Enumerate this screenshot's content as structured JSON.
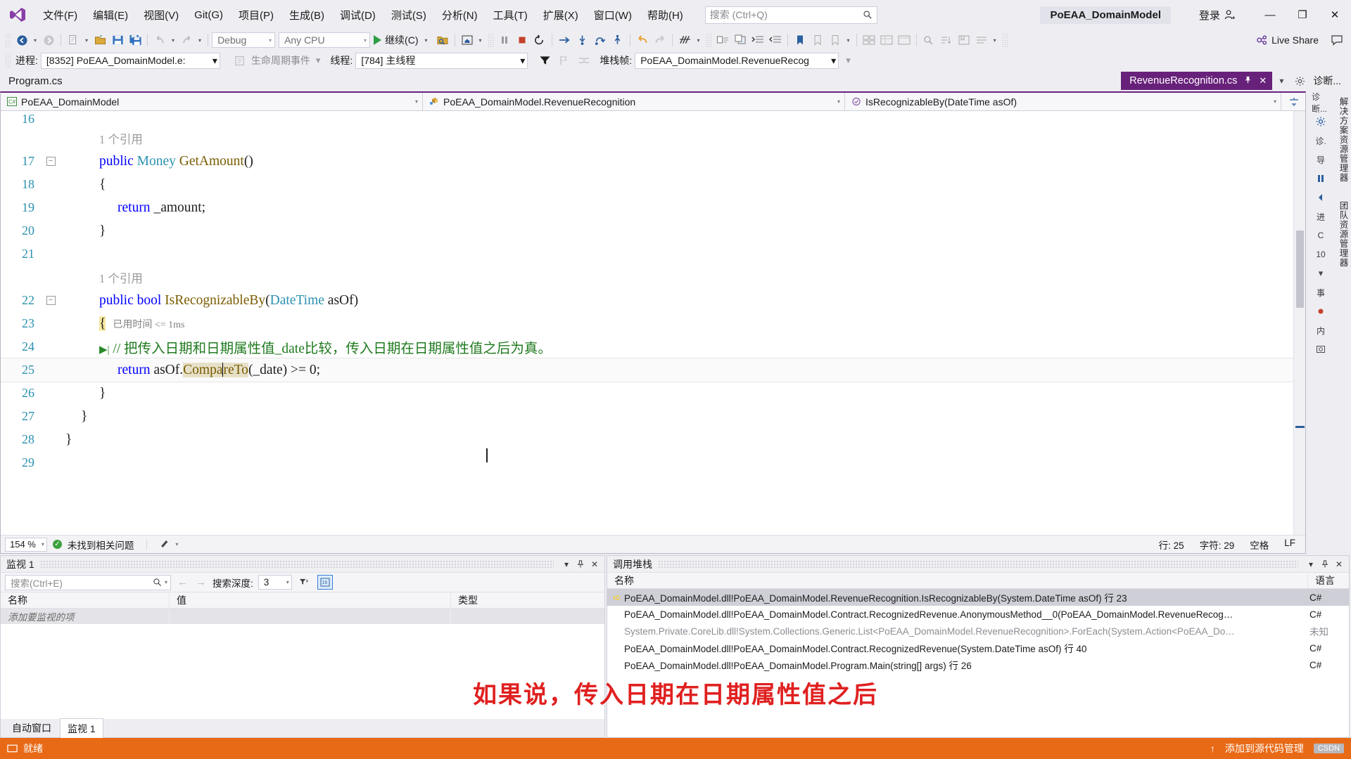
{
  "window": {
    "solution_name": "PoEAA_DomainModel",
    "signin_label": "登录",
    "minimize": "—",
    "maximize": "❐",
    "close": "✕"
  },
  "menu": {
    "logo_icon": "visual-studio-logo",
    "items": [
      "文件(F)",
      "编辑(E)",
      "视图(V)",
      "Git(G)",
      "项目(P)",
      "生成(B)",
      "调试(D)",
      "测试(S)",
      "分析(N)",
      "工具(T)",
      "扩展(X)",
      "窗口(W)",
      "帮助(H)"
    ],
    "search_placeholder": "搜索 (Ctrl+Q)",
    "search_icon": "search-icon"
  },
  "toolbar": {
    "back_icon": "navigate-back-icon",
    "forward_icon": "navigate-forward-icon",
    "new_icon": "new-file-icon",
    "open_icon": "open-folder-icon",
    "save_icon": "save-icon",
    "save_all_icon": "save-all-icon",
    "undo_icon": "undo-icon",
    "redo_icon": "redo-icon",
    "config_value": "Debug",
    "platform_value": "Any CPU",
    "continue_label": "继续(C)",
    "play_icon": "play-triangle-icon",
    "attach_icon": "attach-process-icon",
    "home_icon": "home-icon",
    "pause_icon": "pause-icon",
    "stop_icon": "stop-square-icon",
    "restart_icon": "restart-icon",
    "show_next_icon": "show-next-statement-icon",
    "step_into_icon": "step-into-icon",
    "step_over_icon": "step-over-icon",
    "step_out_icon": "step-out-icon",
    "undo_arrow_icon": "undo-arrow-icon",
    "redo_arrow_icon": "redo-arrow-icon",
    "hot_reload_icon": "hot-reload-icon",
    "bookmark_icon": "bookmark-icon",
    "live_share_label": "Live Share",
    "live_share_icon": "live-share-icon",
    "feedback_icon": "feedback-icon"
  },
  "debug_context": {
    "process_label": "进程:",
    "process_value": "[8352] PoEAA_DomainModel.e:",
    "lifecycle_icon": "lifecycle-events-icon",
    "lifecycle_label": "生命周期事件",
    "thread_label": "线程:",
    "thread_value": "[784] 主线程",
    "filter_icon": "funnel-filter-icon",
    "flag_icon": "flag-icon",
    "parallel_icon": "parallel-stacks-icon",
    "stackframe_label": "堆栈帧:",
    "stackframe_value": "PoEAA_DomainModel.RevenueRecog"
  },
  "tabs": {
    "left_tab": "Program.cs",
    "active_tab": "RevenueRecognition.cs",
    "pin_icon": "pin-icon",
    "close_icon": "close-icon",
    "tab_list_icon": "chevron-down-icon",
    "tab_settings_icon": "gear-icon",
    "diagnostics_label": "诊断..."
  },
  "nav_bar": {
    "project_icon": "csharp-project-icon",
    "project": "PoEAA_DomainModel",
    "class_icon": "class-icon",
    "class": "PoEAA_DomainModel.RevenueRecognition",
    "member_icon": "method-icon",
    "member": "IsRecognizableBy(DateTime asOf)",
    "split_icon": "split-view-icon"
  },
  "code": {
    "elapsed_tooltip": "已用时间 <= 1ms",
    "current_statement_icon": "current-statement-arrow",
    "breakpoint_pencil_icon": "pencil-edit-icon",
    "lines": [
      {
        "num": "16",
        "fold": "",
        "text": ""
      },
      {
        "num": "",
        "fold": "",
        "text": "1 个引用",
        "kind": "codelens",
        "indent": 2
      },
      {
        "num": "17",
        "fold": "minus",
        "text": "public Money GetAmount()",
        "kind": "decl"
      },
      {
        "num": "18",
        "fold": "",
        "text": "{"
      },
      {
        "num": "19",
        "fold": "",
        "text": "return _amount;",
        "kind": "return"
      },
      {
        "num": "20",
        "fold": "",
        "text": "}"
      },
      {
        "num": "21",
        "fold": "",
        "text": ""
      },
      {
        "num": "",
        "fold": "",
        "text": "1 个引用",
        "kind": "codelens",
        "indent": 2
      },
      {
        "num": "22",
        "fold": "minus",
        "text": "public bool IsRecognizableBy(DateTime asOf)",
        "kind": "decl2"
      },
      {
        "num": "23",
        "fold": "",
        "text": "{",
        "kind": "current"
      },
      {
        "num": "24",
        "fold": "",
        "text": "// 把传入日期和日期属性值_date比较，传入日期在日期属性值之后为真。",
        "kind": "comment"
      },
      {
        "num": "25",
        "fold": "",
        "text": "return asOf.CompareTo(_date) >= 0;",
        "kind": "highlighted"
      },
      {
        "num": "26",
        "fold": "",
        "text": "}"
      },
      {
        "num": "27",
        "fold": "",
        "text": "}"
      },
      {
        "num": "28",
        "fold": "",
        "text": "}"
      },
      {
        "num": "29",
        "fold": "",
        "text": ""
      }
    ]
  },
  "editor_status": {
    "zoom": "154 %",
    "issues_icon": "checkmark-circle-icon",
    "issues_text": "未找到相关问题",
    "pen_icon": "ink-annotation-icon",
    "line_label": "行: 25",
    "col_label": "字符: 29",
    "space_label": "空格",
    "eol_label": "LF"
  },
  "right_rails": {
    "diagnostics_label": "诊断...",
    "vertical_labels": [
      "解决方案资源管理器",
      "团队资源管理器"
    ],
    "items": [
      {
        "icon": "gear-icon",
        "label": ""
      },
      {
        "icon": "diagnostics-icon",
        "label": "诊."
      },
      {
        "icon": "navigate-up-icon",
        "label": "导"
      },
      {
        "icon": "pause-icon",
        "label": ""
      },
      {
        "icon": "navigate-left-icon",
        "label": ""
      },
      {
        "icon": "properties-icon",
        "label": "进"
      },
      {
        "icon": "cpu-icon",
        "label": "C"
      },
      {
        "icon": "percent-icon",
        "label": "10"
      },
      {
        "icon": "memory-icon",
        "label": "事"
      },
      {
        "icon": "heap-icon",
        "label": "内"
      },
      {
        "icon": "snapshot-icon",
        "label": ""
      }
    ]
  },
  "watch_panel": {
    "title": "监视 1",
    "dropdown_icon": "chevron-down-icon",
    "pin_icon": "pin-icon",
    "close_icon": "close-icon",
    "search_placeholder": "搜索(Ctrl+E)",
    "search_icon": "search-icon",
    "prev_icon": "arrow-left-icon",
    "next_icon": "arrow-right-icon",
    "depth_label": "搜索深度:",
    "depth_value": "3",
    "filter_icon": "filter-icon",
    "hex_icon": "hex-display-icon",
    "columns": [
      "名称",
      "值",
      "类型"
    ],
    "rows": [
      {
        "name": "添加要监视的项",
        "value": "",
        "type": "",
        "placeholder": true
      }
    ],
    "tabs": [
      {
        "label": "自动窗口",
        "selected": false
      },
      {
        "label": "监视 1",
        "selected": true
      }
    ]
  },
  "callstack_panel": {
    "title": "调用堆栈",
    "dropdown_icon": "chevron-down-icon",
    "pin_icon": "pin-icon",
    "close_icon": "close-icon",
    "columns": [
      "名称",
      "语言"
    ],
    "rows": [
      {
        "name": "PoEAA_DomainModel.dll!PoEAA_DomainModel.RevenueRecognition.IsRecognizableBy(System.DateTime asOf) 行 23",
        "lang": "C#",
        "active": true,
        "dim": false
      },
      {
        "name": "PoEAA_DomainModel.dll!PoEAA_DomainModel.Contract.RecognizedRevenue.AnonymousMethod__0(PoEAA_DomainModel.RevenueRecog…",
        "lang": "C#",
        "active": false,
        "dim": false
      },
      {
        "name": "System.Private.CoreLib.dll!System.Collections.Generic.List<PoEAA_DomainModel.RevenueRecognition>.ForEach(System.Action<PoEAA_Do…",
        "lang": "未知",
        "active": false,
        "dim": true
      },
      {
        "name": "PoEAA_DomainModel.dll!PoEAA_DomainModel.Contract.RecognizedRevenue(System.DateTime asOf) 行 40",
        "lang": "C#",
        "active": false,
        "dim": false
      },
      {
        "name": "PoEAA_DomainModel.dll!PoEAA_DomainModel.Program.Main(string[] args) 行 26",
        "lang": "C#",
        "active": false,
        "dim": false
      }
    ]
  },
  "subtitle": {
    "text": "如果说，传入日期在日期属性值之后",
    "color": "#e02020"
  },
  "statusbar": {
    "ready_icon": "ready-icon",
    "ready_text": "就绪",
    "source_control_icon": "upload-arrow-icon",
    "source_control_text": "添加到源代码管理",
    "watermark": "CSDN"
  },
  "colors": {
    "accent_purple": "#68217a",
    "statusbar_orange": "#e86a17",
    "chrome": "#eeeef2",
    "keyword_blue": "#0000ff",
    "type_teal": "#2b91af",
    "comment_green": "#1f7a1f"
  }
}
